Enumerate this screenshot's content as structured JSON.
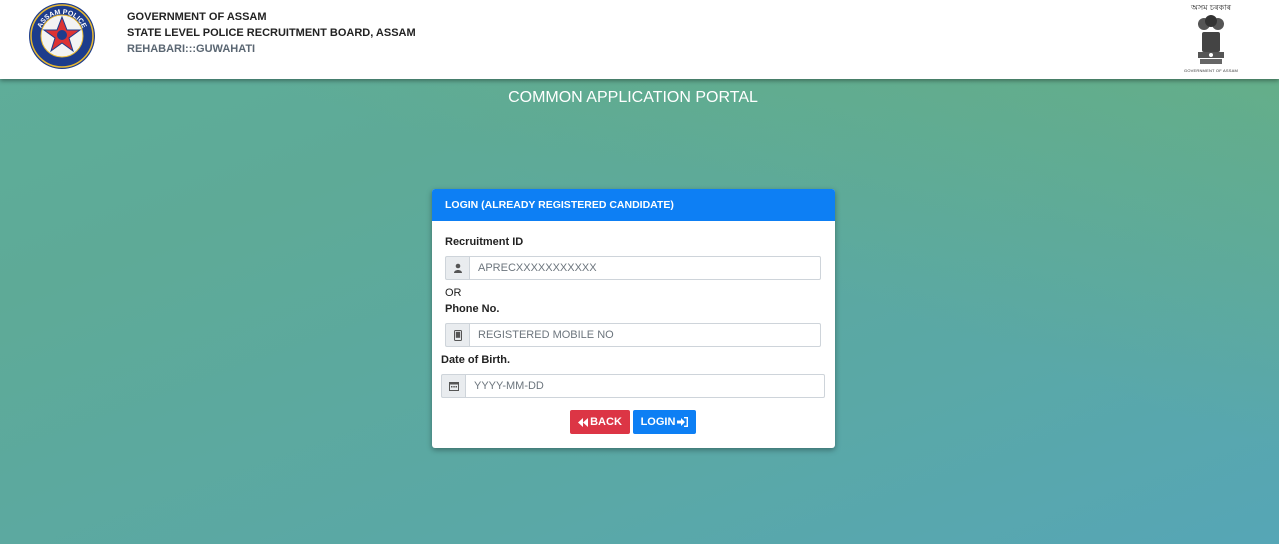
{
  "header": {
    "line1": "GOVERNMENT OF ASSAM",
    "line2": "STATE LEVEL POLICE RECRUITMENT BOARD, ASSAM",
    "line3": "REHABARI:::GUWAHATI",
    "emblem_top_text": "অসম চৰকাৰ",
    "emblem_bottom_text": "GOVERNMENT OF ASSAM",
    "logo_left_text": "ASSAM POLICE"
  },
  "portal_title": "COMMON APPLICATION PORTAL",
  "login_card": {
    "title": "LOGIN (ALREADY REGISTERED CANDIDATE)",
    "recruitment_id_label": "Recruitment ID",
    "recruitment_id_placeholder": "APRECXXXXXXXXXXX",
    "or_text": "OR",
    "phone_label": "Phone No.",
    "phone_placeholder": "REGISTERED MOBILE NO",
    "dob_label": "Date of Birth.",
    "dob_placeholder": "YYYY-MM-DD",
    "back_label": "BACK",
    "login_label": "LOGIN"
  },
  "icons": {
    "recruitment_id": "user-icon",
    "phone": "mobile-icon",
    "dob": "calendar-icon",
    "back": "backward-icon",
    "login": "sign-in-icon"
  },
  "colors": {
    "primary": "#0d7ff4",
    "danger": "#dc3545",
    "background_gradient": [
      "#66b07a",
      "#56a6b6"
    ]
  }
}
